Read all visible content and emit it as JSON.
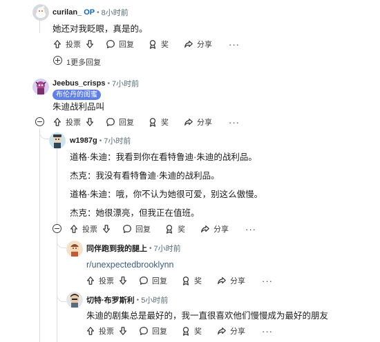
{
  "labels": {
    "upvote": "投票",
    "reply": "回复",
    "award": "奖",
    "share": "分享",
    "more": "···",
    "dot": "•"
  },
  "comments": [
    {
      "author": "curilan_",
      "op_tag": "OP",
      "time": "8小时前",
      "body": [
        "她还对我眨眼，真是的。"
      ],
      "more_replies": "1更多回复"
    },
    {
      "author": "Jeebus_crisps",
      "time": "7小时前",
      "flair": "布伦丹的闺蜜",
      "body": [
        "朱迪战利品叫"
      ]
    },
    {
      "author": "w1987g",
      "time": "7小时前",
      "body": [
        "道格·朱迪：我看到你在看特鲁迪·朱迪的战利品。",
        "杰克：我没有看特鲁迪·朱迪的战利品。",
        "道格·朱迪：哦，你不认为她很可爱，别这么傲慢。",
        "杰克：她很漂亮，但我正在值班。"
      ]
    },
    {
      "author": "同伴跑到我的腿上",
      "time": "7小时前",
      "link": "r/unexpectedbrooklynn"
    },
    {
      "author": "切特·布罗斯利",
      "time": "5小时前",
      "body": [
        "朱迪的剧集总是最好的，我一直很喜欢他们慢慢成为最好的朋友"
      ]
    }
  ]
}
